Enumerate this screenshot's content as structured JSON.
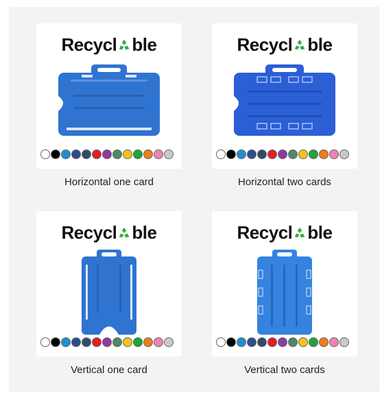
{
  "products": [
    {
      "brand": "Recycl",
      "brand_tail": "ble",
      "caption": "Horizontal one card",
      "orientation": "horizontal",
      "cards": 1,
      "color": "#2f74d0"
    },
    {
      "brand": "Recycl",
      "brand_tail": "ble",
      "caption": "Horizontal two cards",
      "orientation": "horizontal",
      "cards": 2,
      "color": "#2a5fd6"
    },
    {
      "brand": "Recycl",
      "brand_tail": "ble",
      "caption": "Vertical one card",
      "orientation": "vertical",
      "cards": 1,
      "color": "#2f74d0"
    },
    {
      "brand": "Recycl",
      "brand_tail": "ble",
      "caption": "Vertical two cards",
      "orientation": "vertical",
      "cards": 2,
      "color": "#3483df"
    }
  ],
  "swatch_colors": [
    "#ffffff",
    "#000000",
    "#1d8fd6",
    "#2c4e8e",
    "#324b6b",
    "#e21f26",
    "#8e3aa0",
    "#4e8a63",
    "#f2c418",
    "#23a438",
    "#ef7d1a",
    "#ee82b6",
    "#c9c9c9"
  ],
  "recycle_icon_color": "#2eaa3f"
}
